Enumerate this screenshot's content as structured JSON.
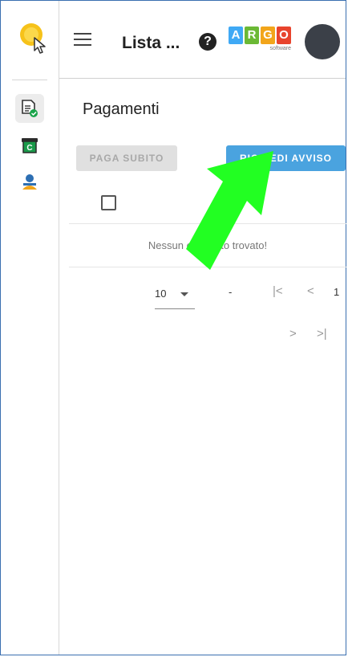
{
  "header": {
    "title": "Lista ...",
    "help_icon": "?",
    "brand": {
      "letters": [
        "A",
        "R",
        "G",
        "O"
      ],
      "colors": [
        "#3fa9f5",
        "#6bb935",
        "#f2a51a",
        "#e8442d"
      ],
      "sub": "software"
    }
  },
  "sidebar": {
    "logo_icon": "hand-cursor-logo-icon",
    "items": [
      {
        "icon": "document-check-icon",
        "active": true
      },
      {
        "icon": "receipt-c-icon",
        "active": false
      },
      {
        "icon": "user-dollar-icon",
        "active": false
      }
    ]
  },
  "main": {
    "page_title": "Pagamenti",
    "buttons": {
      "paga_subito": "PAGA SUBITO",
      "richiedi_avviso": "RICHIEDI AVVISO"
    },
    "table": {
      "empty_message": "Nessun elemento trovato!"
    },
    "pagination": {
      "page_size": "10",
      "range": "-",
      "first": "|<",
      "prev": "<",
      "page": "1",
      "next": ">",
      "last": ">|"
    }
  },
  "colors": {
    "accent": "#4aa3df",
    "arrow": "#22ff22",
    "disabled": "#e0e0e0"
  }
}
